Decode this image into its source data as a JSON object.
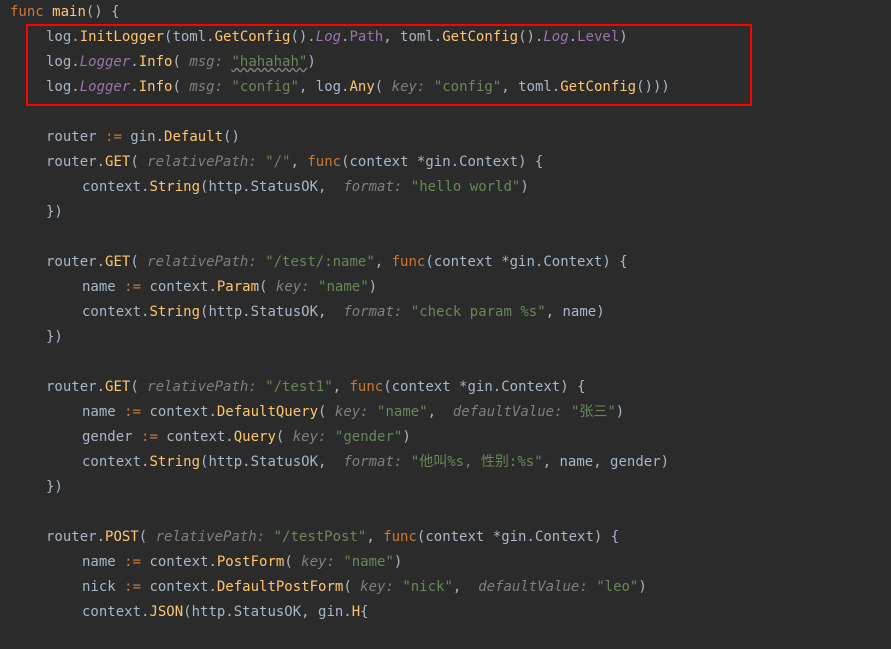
{
  "code": {
    "l1": {
      "func": "func",
      "main": "main",
      "paren": "()",
      "brace": " {"
    },
    "l2": {
      "pre": "log.",
      "init": "InitLogger",
      "p1": "(toml.",
      "gc1": "GetConfig",
      "p2": "().",
      "log1": "Log",
      "p3": ".",
      "path": "Path",
      "c1": ", toml.",
      "gc2": "GetConfig",
      "p4": "().",
      "log2": "Log",
      "p5": ".",
      "level": "Level",
      "end": ")"
    },
    "l3": {
      "pre": "log.",
      "logger": "Logger",
      "dot": ".",
      "info": "Info",
      "open": "( ",
      "msg": "msg:",
      "sp": " ",
      "str": "\"hahahah\"",
      "end": ")"
    },
    "l4": {
      "pre": "log.",
      "logger": "Logger",
      "dot": ".",
      "info": "Info",
      "open": "( ",
      "msg": "msg:",
      "sp": " ",
      "str1": "\"config\"",
      "c": ", log.",
      "any": "Any",
      "open2": "( ",
      "key": "key:",
      "sp2": " ",
      "str2": "\"config\"",
      "c2": ", toml.",
      "gc": "GetConfig",
      "end": "()))"
    },
    "l6": {
      "router": "router ",
      "op": ":=",
      "sp": " gin.",
      "def": "Default",
      "end": "()"
    },
    "l7": {
      "pre": "router.",
      "get": "GET",
      "open": "( ",
      "rp": "relativePath:",
      "sp": " ",
      "str": "\"/\"",
      "c": ", ",
      "func": "func",
      "sig": "(context *gin.Context) {"
    },
    "l8": {
      "pre": "context.",
      "string": "String",
      "open": "(http.StatusOK,  ",
      "fmt": "format:",
      "sp": " ",
      "str": "\"hello world\"",
      "end": ")"
    },
    "l9": {
      "end": "})"
    },
    "l11": {
      "pre": "router.",
      "get": "GET",
      "open": "( ",
      "rp": "relativePath:",
      "sp": " ",
      "str": "\"/test/:name\"",
      "c": ", ",
      "func": "func",
      "sig": "(context *gin.Context) {"
    },
    "l12": {
      "name": "name ",
      "op": ":=",
      "sp": " context.",
      "param": "Param",
      "open": "( ",
      "key": "key:",
      "sp2": " ",
      "str": "\"name\"",
      "end": ")"
    },
    "l13": {
      "pre": "context.",
      "string": "String",
      "open": "(http.StatusOK,  ",
      "fmt": "format:",
      "sp": " ",
      "str": "\"check param %s\"",
      "c": ", name)"
    },
    "l14": {
      "end": "})"
    },
    "l16": {
      "pre": "router.",
      "get": "GET",
      "open": "( ",
      "rp": "relativePath:",
      "sp": " ",
      "str": "\"/test1\"",
      "c": ", ",
      "func": "func",
      "sig": "(context *gin.Context) {"
    },
    "l17": {
      "name": "name ",
      "op": ":=",
      "sp": " context.",
      "dq": "DefaultQuery",
      "open": "( ",
      "key": "key:",
      "sp2": " ",
      "str": "\"name\"",
      "c": ",  ",
      "dv": "defaultValue:",
      "sp3": " ",
      "str2": "\"张三\"",
      "end": ")"
    },
    "l18": {
      "gender": "gender ",
      "op": ":=",
      "sp": " context.",
      "query": "Query",
      "open": "( ",
      "key": "key:",
      "sp2": " ",
      "str": "\"gender\"",
      "end": ")"
    },
    "l19": {
      "pre": "context.",
      "string": "String",
      "open": "(http.StatusOK,  ",
      "fmt": "format:",
      "sp": " ",
      "str": "\"他叫%s, 性别:%s\"",
      "c": ", name, gender)"
    },
    "l20": {
      "end": "})"
    },
    "l22": {
      "pre": "router.",
      "post": "POST",
      "open": "( ",
      "rp": "relativePath:",
      "sp": " ",
      "str": "\"/testPost\"",
      "c": ", ",
      "func": "func",
      "sig": "(context *gin.Context) {"
    },
    "l23": {
      "name": "name ",
      "op": ":=",
      "sp": " context.",
      "pf": "PostForm",
      "open": "( ",
      "key": "key:",
      "sp2": " ",
      "str": "\"name\"",
      "end": ")"
    },
    "l24": {
      "nick": "nick ",
      "op": ":=",
      "sp": " context.",
      "dpf": "DefaultPostForm",
      "open": "( ",
      "key": "key:",
      "sp2": " ",
      "str": "\"nick\"",
      "c": ",  ",
      "dv": "defaultValue:",
      "sp3": " ",
      "str2": "\"leo\"",
      "end": ")"
    },
    "l25": {
      "pre": "context.",
      "json": "JSON",
      "open": "(http.StatusOK, gin.",
      "h": "H",
      "brace": "{"
    }
  }
}
